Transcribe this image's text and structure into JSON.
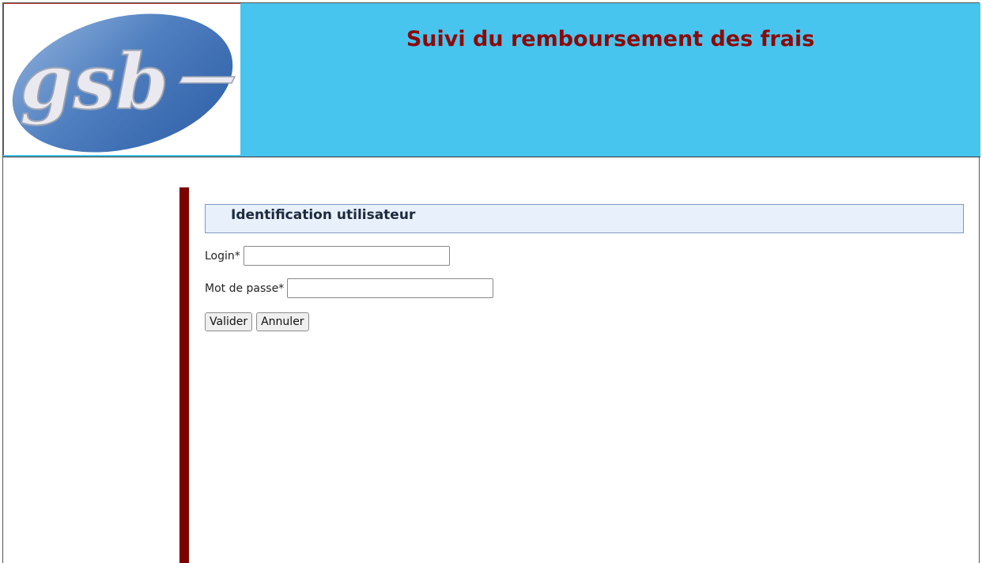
{
  "header": {
    "logo_text": "gsb",
    "title": "Suivi du remboursement des frais",
    "colors": {
      "banner": "#48c5ee",
      "title": "#8b0a0a",
      "sidebar_bar": "#7b0000"
    }
  },
  "login_panel": {
    "heading": "Identification utilisateur",
    "fields": {
      "login": {
        "label": "Login*",
        "value": "",
        "placeholder": ""
      },
      "password": {
        "label": "Mot de passe*",
        "value": "",
        "placeholder": ""
      }
    },
    "buttons": {
      "submit_label": "Valider",
      "reset_label": "Annuler"
    }
  }
}
